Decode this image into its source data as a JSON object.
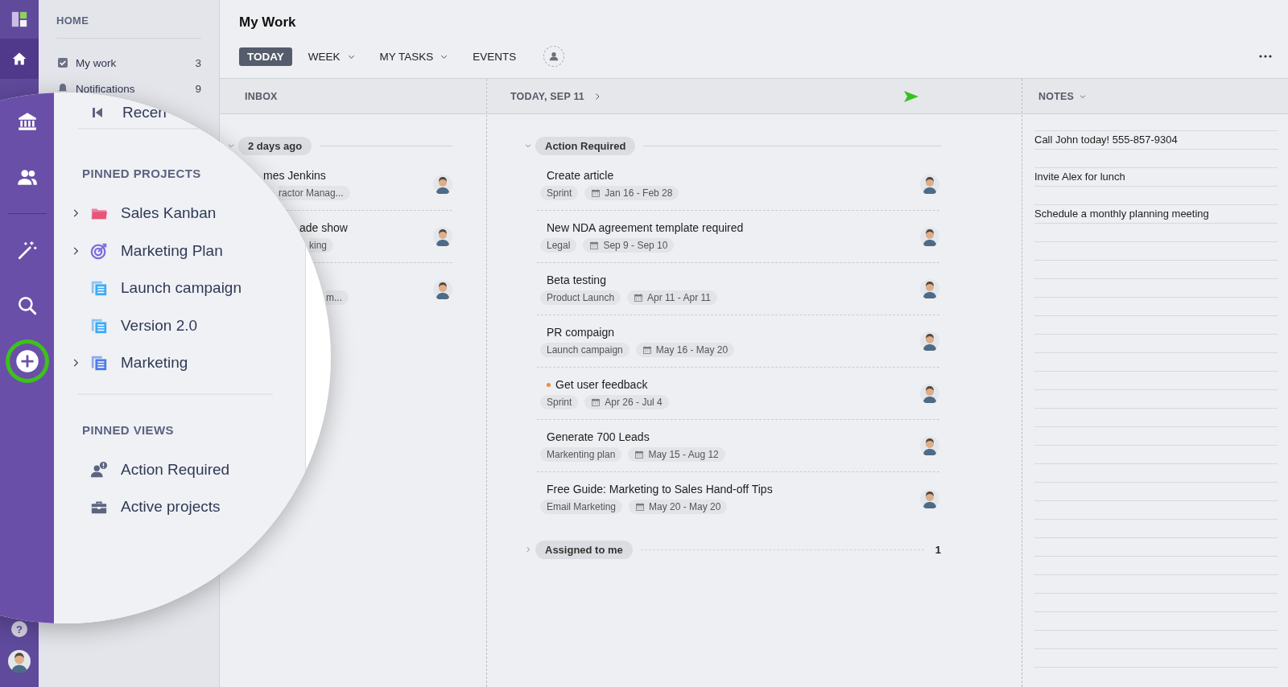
{
  "rail": {
    "items": [
      {
        "kind": "home",
        "selected": true
      }
    ],
    "help": "?"
  },
  "home_panel": {
    "title": "HOME",
    "items": [
      {
        "label": "My work",
        "count": "3",
        "kind": "checkbox"
      },
      {
        "label": "Notifications",
        "count": "9",
        "kind": "bell"
      }
    ]
  },
  "header": {
    "title": "My Work",
    "tabs": [
      {
        "label": "TODAY",
        "selected": true,
        "dropdown": false
      },
      {
        "label": "WEEK",
        "selected": false,
        "dropdown": true
      },
      {
        "label": "MY TASKS",
        "selected": false,
        "dropdown": true
      },
      {
        "label": "EVENTS",
        "selected": false,
        "dropdown": false
      }
    ]
  },
  "inbox": {
    "title": "INBOX",
    "group": {
      "label": "2 days ago",
      "expanded": true
    },
    "items": [
      {
        "title": "mes Jenkins",
        "tag": "ractor Manag..."
      },
      {
        "title": "ade show",
        "tag": "king"
      },
      {
        "tag": "m..."
      }
    ]
  },
  "today": {
    "title": "TODAY, SEP 11",
    "groups": [
      {
        "label": "Action Required",
        "expanded": true,
        "items": [
          {
            "title": "Create article",
            "tag": "Sprint",
            "dates": "Jan 16 - Feb 28",
            "flagged": false
          },
          {
            "title": "New NDA agreement template required",
            "tag": "Legal",
            "dates": "Sep 9 - Sep 10",
            "flagged": false
          },
          {
            "title": "Beta testing",
            "tag": "Product Launch",
            "dates": "Apr 11 - Apr 11",
            "flagged": false
          },
          {
            "title": "PR compaign",
            "tag": "Launch campaign",
            "dates": "May 16 - May 20",
            "flagged": false
          },
          {
            "title": "Get user feedback",
            "tag": "Sprint",
            "dates": "Apr 26 - Jul 4",
            "flagged": true
          },
          {
            "title": "Generate 700 Leads",
            "tag": "Markenting plan",
            "dates": "May 15 - Aug 12",
            "flagged": false
          },
          {
            "title": "Free Guide: Marketing to Sales Hand-off Tips",
            "tag": "Email Marketing",
            "dates": "May 20 - May 20",
            "flagged": false
          }
        ]
      },
      {
        "label": "Assigned to me",
        "expanded": false,
        "count": "1"
      }
    ]
  },
  "notes": {
    "title": "NOTES",
    "lines": [
      "Call John today! 555-857-9304",
      "Invite Alex for lunch",
      "Schedule a monthly planning meeting"
    ]
  },
  "lens": {
    "rail": [
      {
        "kind": "bank",
        "highlighted": false
      },
      {
        "kind": "people",
        "highlighted": false
      },
      {
        "kind": "wand",
        "highlighted": false
      },
      {
        "kind": "search",
        "highlighted": false
      },
      {
        "kind": "add",
        "highlighted": true
      }
    ],
    "recent": "Recen",
    "sections": [
      {
        "title": "PINNED PROJECTS",
        "items": [
          {
            "label": "Sales Kanban",
            "kind": "folder",
            "color": "#e8557a",
            "expandable": true
          },
          {
            "label": "Marketing Plan",
            "kind": "target",
            "color": "#7b6ce0",
            "expandable": true
          },
          {
            "label": "Launch campaign",
            "kind": "list",
            "color": "#3fa9f5",
            "expandable": false
          },
          {
            "label": "Version 2.0",
            "kind": "list",
            "color": "#3fa9f5",
            "expandable": false
          },
          {
            "label": "Marketing",
            "kind": "list",
            "color": "#4b7bec",
            "expandable": true
          }
        ]
      },
      {
        "title": "PINNED VIEWS",
        "items": [
          {
            "label": "Action Required",
            "kind": "person-alert",
            "color": "#5c6480",
            "expandable": false
          },
          {
            "label": "Active projects",
            "kind": "briefcase",
            "color": "#5c6480",
            "expandable": false
          }
        ]
      }
    ]
  }
}
